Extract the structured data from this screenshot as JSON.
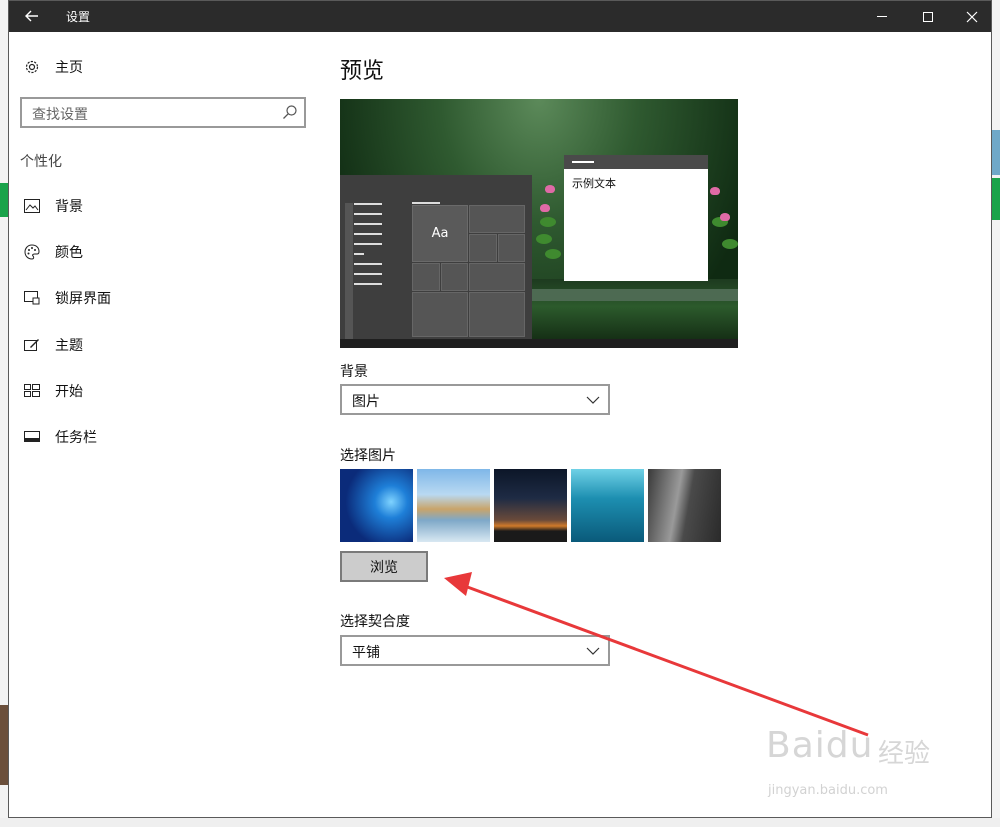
{
  "window": {
    "title": "设置",
    "back_icon": "back-arrow-icon",
    "minimize_icon": "minimize-icon",
    "maximize_icon": "maximize-icon",
    "close_icon": "close-icon"
  },
  "sidebar": {
    "home": {
      "label": "主页",
      "icon": "gear-icon"
    },
    "search": {
      "placeholder": "查找设置",
      "icon": "search-icon"
    },
    "section": "个性化",
    "items": [
      {
        "label": "背景",
        "icon": "picture-icon"
      },
      {
        "label": "颜色",
        "icon": "palette-icon"
      },
      {
        "label": "锁屏界面",
        "icon": "lock-screen-icon"
      },
      {
        "label": "主题",
        "icon": "theme-brush-icon"
      },
      {
        "label": "开始",
        "icon": "start-grid-icon"
      },
      {
        "label": "任务栏",
        "icon": "taskbar-icon"
      }
    ]
  },
  "main": {
    "heading": "预览",
    "preview": {
      "tile_text": "Aa",
      "sample_text": "示例文本"
    },
    "background": {
      "label": "背景",
      "value": "图片"
    },
    "choose_picture": {
      "label": "选择图片",
      "thumbnails": [
        "windows-blue-wallpaper",
        "beach-rocks-wallpaper",
        "night-sky-tent-wallpaper",
        "underwater-swimmer-wallpaper",
        "rock-cliff-wallpaper"
      ]
    },
    "browse_button": "浏览",
    "fit": {
      "label": "选择契合度",
      "value": "平铺"
    }
  },
  "annotation": {
    "arrow_color": "#e8383a"
  },
  "watermark": {
    "brand": "Bai",
    "brand2": "du",
    "cn": "经验",
    "url": "jingyan.baidu.com"
  }
}
